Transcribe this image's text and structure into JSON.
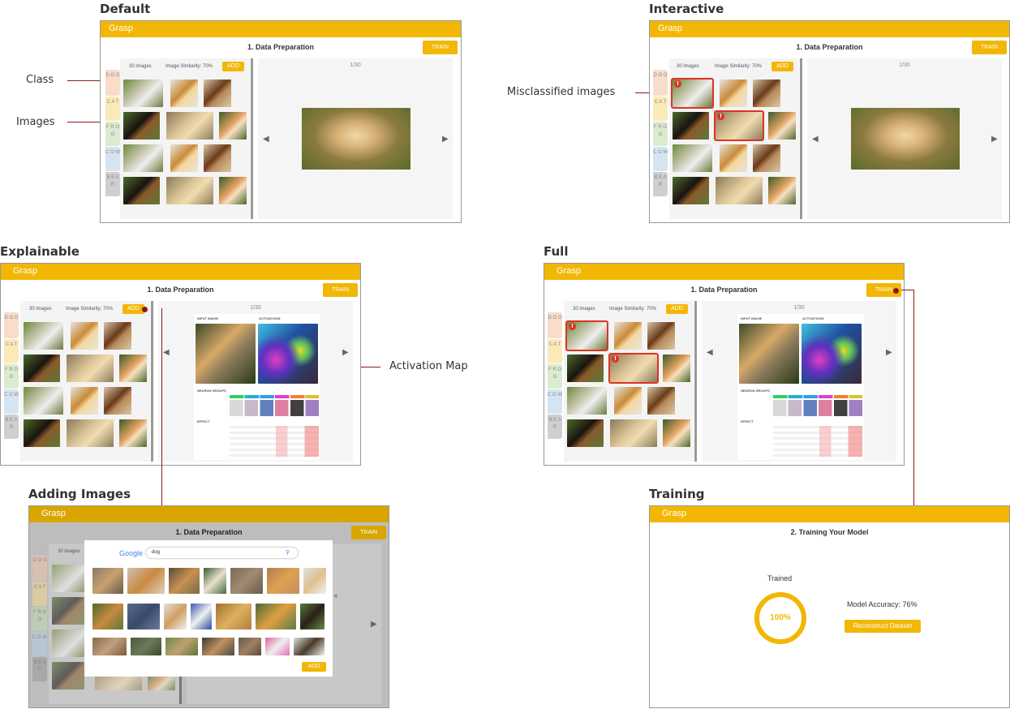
{
  "sections": {
    "default": "Default",
    "interactive": "Interactive",
    "explainable": "Explainable",
    "full": "Full",
    "adding": "Adding Images",
    "training": "Training"
  },
  "annotations": {
    "class": "Class",
    "images": "Images",
    "misclassified": "Misclassified images",
    "activation": "Activation Map"
  },
  "app": {
    "name": "Grasp",
    "step1": "1. Data Preparation",
    "step2": "2. Training Your Model",
    "train": "TRAIN",
    "add": "ADD",
    "count": "30 images",
    "similarity": "Image Similarity: 70%",
    "page": "1/30"
  },
  "classes": [
    "D O G",
    "C A T",
    "F R O G",
    "C O W",
    "B E A R"
  ],
  "explain": {
    "input": "INPUT IMAGE",
    "activations": "ACTIVATIONS",
    "neuron_groups": "NEURON GROUPS",
    "effect": "EFFECT"
  },
  "search": {
    "engine": "Google",
    "query": "dog"
  },
  "training": {
    "status": "Trained",
    "progress": "100%",
    "accuracy": "Model Accuracy: 76%",
    "reconstruct": "Reconstruct Dataset"
  },
  "colors": {
    "accent": "#f2b705",
    "error": "#d32222",
    "annotation": "#8b1a1a"
  }
}
